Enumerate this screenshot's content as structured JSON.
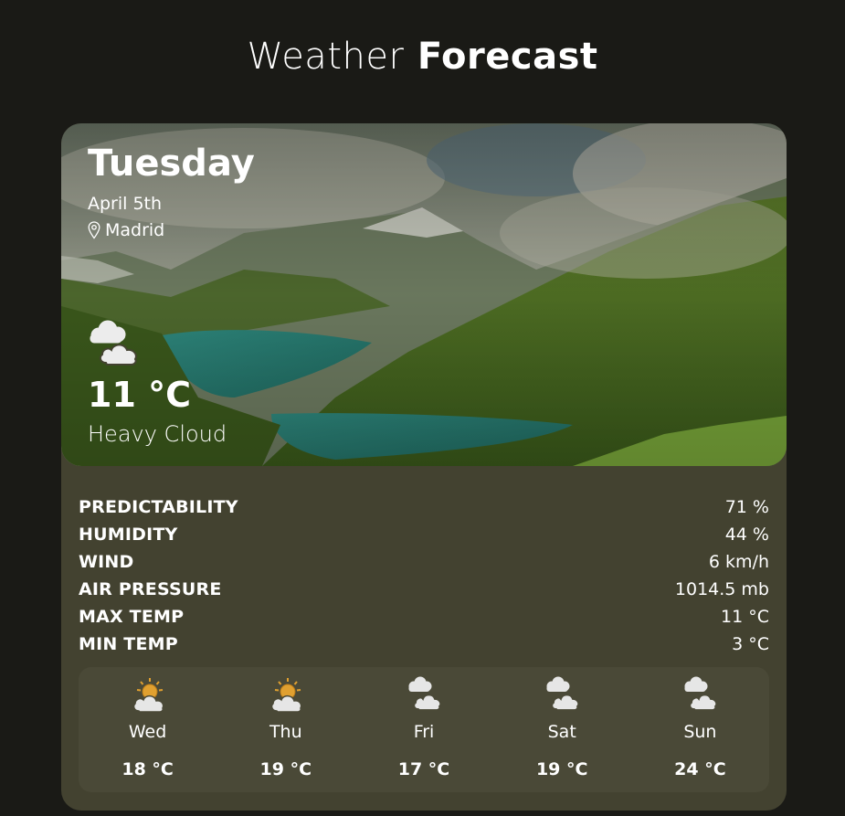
{
  "header": {
    "title_light": "Weather",
    "title_bold": "Forecast"
  },
  "current": {
    "day": "Tuesday",
    "date": "April 5th",
    "location": "Madrid",
    "temperature": "11 °C",
    "condition": "Heavy Cloud",
    "icon": "cloud-icon"
  },
  "stats": [
    {
      "label": "PREDICTABILITY",
      "value": "71 %"
    },
    {
      "label": "HUMIDITY",
      "value": "44 %"
    },
    {
      "label": "WIND",
      "value": "6 km/h"
    },
    {
      "label": "AIR PRESSURE",
      "value": "1014.5 mb"
    },
    {
      "label": "MAX TEMP",
      "value": "11 °C"
    },
    {
      "label": "MIN TEMP",
      "value": "3 °C"
    }
  ],
  "forecast": [
    {
      "day": "Wed",
      "temperature": "18 °C",
      "icon": "sun-cloud-icon"
    },
    {
      "day": "Thu",
      "temperature": "19 °C",
      "icon": "sun-cloud-icon"
    },
    {
      "day": "Fri",
      "temperature": "17 °C",
      "icon": "cloud-icon"
    },
    {
      "day": "Sat",
      "temperature": "19 °C",
      "icon": "cloud-icon"
    },
    {
      "day": "Sun",
      "temperature": "24 °C",
      "icon": "cloud-icon"
    }
  ],
  "colors": {
    "background": "#1a1a16",
    "card": "#434230",
    "forecast_panel": "#4a4937",
    "sun": "#e0a030"
  }
}
